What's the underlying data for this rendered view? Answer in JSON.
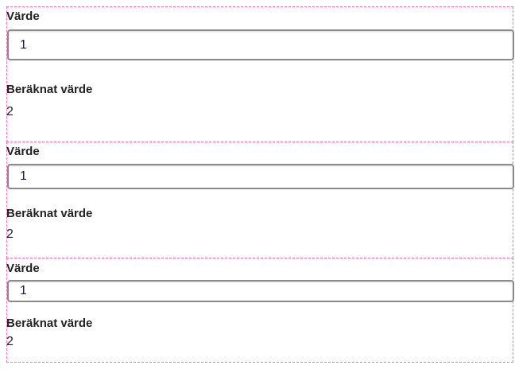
{
  "sections": [
    {
      "input_label": "Värde",
      "input_value": "1",
      "computed_label": "Beräknat värde",
      "computed_value": "2"
    },
    {
      "input_label": "Värde",
      "input_value": "1",
      "computed_label": "Beräknat värde",
      "computed_value": "2"
    },
    {
      "input_label": "Värde",
      "input_value": "1",
      "computed_label": "Beräknat värde",
      "computed_value": "2"
    }
  ]
}
